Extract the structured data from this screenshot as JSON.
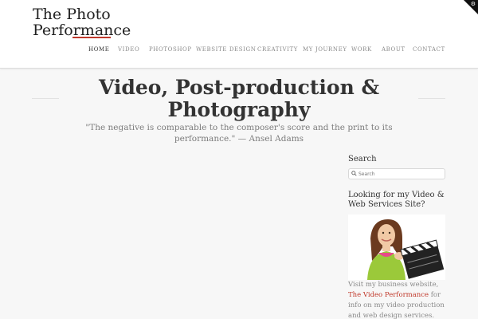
{
  "site": {
    "logo_line1": "The Photo",
    "logo_line2": "Performance"
  },
  "nav": {
    "items": [
      {
        "label": "HOME",
        "active": true
      },
      {
        "label": "VIDEO"
      },
      {
        "label": "PHOTOSHOP"
      },
      {
        "label": "WEBSITE DESIGN"
      },
      {
        "label": "CREATIVITY"
      },
      {
        "label": "MY JOURNEY"
      },
      {
        "label": "WORK"
      },
      {
        "label": "ABOUT"
      },
      {
        "label": "CONTACT"
      }
    ]
  },
  "hero": {
    "title": "Video, Post-production & Photography",
    "quote": "\"The negative is comparable to the composer's score and the print to its performance.\" — Ansel Adams"
  },
  "sidebar": {
    "search_title": "Search",
    "search_placeholder": "Search",
    "promo_title": "Looking for my Video & Web Services Site?",
    "promo_text_before": "Visit my business website, ",
    "promo_link": "The Video Performance",
    "promo_text_after": " for info on my video production and web design services."
  },
  "colors": {
    "accent": "#c0392b",
    "background": "#f7f7f7",
    "header": "#ffffff"
  },
  "icons": {
    "corner": "gear-icon",
    "search": "search-icon"
  }
}
